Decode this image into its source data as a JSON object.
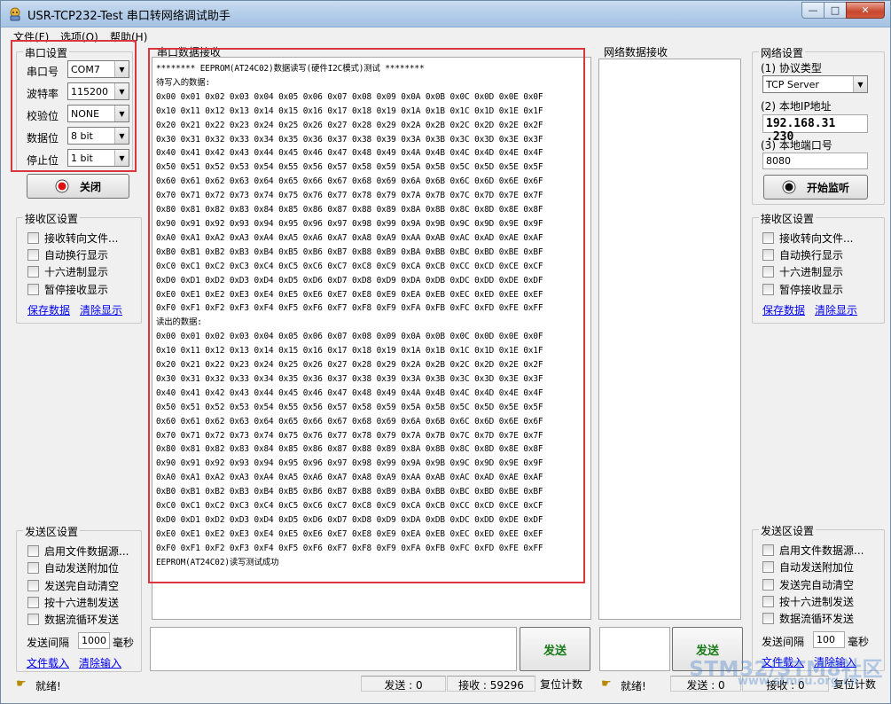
{
  "window": {
    "title": "USR-TCP232-Test 串口转网络调试助手",
    "controls": {
      "minimize": "—",
      "maximize": "□",
      "close": "✕"
    }
  },
  "menu": [
    "文件(F)",
    "选项(O)",
    "帮助(H)"
  ],
  "serial_settings": {
    "title": "串口设置",
    "fields": [
      {
        "label": "串口号",
        "value": "COM7"
      },
      {
        "label": "波特率",
        "value": "115200"
      },
      {
        "label": "校验位",
        "value": "NONE"
      },
      {
        "label": "数据位",
        "value": "8 bit"
      },
      {
        "label": "停止位",
        "value": "1 bit"
      }
    ],
    "close_button": "关闭"
  },
  "left_receive_settings": {
    "title": "接收区设置",
    "options": [
      "接收转向文件...",
      "自动换行显示",
      "十六进制显示",
      "暂停接收显示"
    ],
    "save_link": "保存数据",
    "clear_link": "清除显示"
  },
  "left_send_settings": {
    "title": "发送区设置",
    "options": [
      "启用文件数据源...",
      "自动发送附加位",
      "发送完自动清空",
      "按十六进制发送",
      "数据流循环发送"
    ],
    "interval_label": "发送间隔",
    "interval_value": "1000",
    "interval_unit": "毫秒",
    "load_link": "文件载入",
    "clear_link": "清除输入"
  },
  "serial_receive": {
    "title": "串口数据接收",
    "header": "******** EEPROM(AT24C02)数据读写(硬件I2C模式)测试 ********",
    "write_label": "待写入的数据:",
    "write_rows": [
      "0x00 0x01 0x02 0x03 0x04 0x05 0x06 0x07 0x08 0x09 0x0A 0x0B 0x0C 0x0D 0x0E 0x0F",
      "0x10 0x11 0x12 0x13 0x14 0x15 0x16 0x17 0x18 0x19 0x1A 0x1B 0x1C 0x1D 0x1E 0x1F",
      "0x20 0x21 0x22 0x23 0x24 0x25 0x26 0x27 0x28 0x29 0x2A 0x2B 0x2C 0x2D 0x2E 0x2F",
      "0x30 0x31 0x32 0x33 0x34 0x35 0x36 0x37 0x38 0x39 0x3A 0x3B 0x3C 0x3D 0x3E 0x3F",
      "0x40 0x41 0x42 0x43 0x44 0x45 0x46 0x47 0x48 0x49 0x4A 0x4B 0x4C 0x4D 0x4E 0x4F",
      "0x50 0x51 0x52 0x53 0x54 0x55 0x56 0x57 0x58 0x59 0x5A 0x5B 0x5C 0x5D 0x5E 0x5F",
      "0x60 0x61 0x62 0x63 0x64 0x65 0x66 0x67 0x68 0x69 0x6A 0x6B 0x6C 0x6D 0x6E 0x6F",
      "0x70 0x71 0x72 0x73 0x74 0x75 0x76 0x77 0x78 0x79 0x7A 0x7B 0x7C 0x7D 0x7E 0x7F",
      "0x80 0x81 0x82 0x83 0x84 0x85 0x86 0x87 0x88 0x89 0x8A 0x8B 0x8C 0x8D 0x8E 0x8F",
      "0x90 0x91 0x92 0x93 0x94 0x95 0x96 0x97 0x98 0x99 0x9A 0x9B 0x9C 0x9D 0x9E 0x9F",
      "0xA0 0xA1 0xA2 0xA3 0xA4 0xA5 0xA6 0xA7 0xA8 0xA9 0xAA 0xAB 0xAC 0xAD 0xAE 0xAF",
      "0xB0 0xB1 0xB2 0xB3 0xB4 0xB5 0xB6 0xB7 0xB8 0xB9 0xBA 0xBB 0xBC 0xBD 0xBE 0xBF",
      "0xC0 0xC1 0xC2 0xC3 0xC4 0xC5 0xC6 0xC7 0xC8 0xC9 0xCA 0xCB 0xCC 0xCD 0xCE 0xCF",
      "0xD0 0xD1 0xD2 0xD3 0xD4 0xD5 0xD6 0xD7 0xD8 0xD9 0xDA 0xDB 0xDC 0xDD 0xDE 0xDF",
      "0xE0 0xE1 0xE2 0xE3 0xE4 0xE5 0xE6 0xE7 0xE8 0xE9 0xEA 0xEB 0xEC 0xED 0xEE 0xEF",
      "0xF0 0xF1 0xF2 0xF3 0xF4 0xF5 0xF6 0xF7 0xF8 0xF9 0xFA 0xFB 0xFC 0xFD 0xFE 0xFF"
    ],
    "read_label": "读出的数据:",
    "read_rows": [
      "0x00 0x01 0x02 0x03 0x04 0x05 0x06 0x07 0x08 0x09 0x0A 0x0B 0x0C 0x0D 0x0E 0x0F",
      "0x10 0x11 0x12 0x13 0x14 0x15 0x16 0x17 0x18 0x19 0x1A 0x1B 0x1C 0x1D 0x1E 0x1F",
      "0x20 0x21 0x22 0x23 0x24 0x25 0x26 0x27 0x28 0x29 0x2A 0x2B 0x2C 0x2D 0x2E 0x2F",
      "0x30 0x31 0x32 0x33 0x34 0x35 0x36 0x37 0x38 0x39 0x3A 0x3B 0x3C 0x3D 0x3E 0x3F",
      "0x40 0x41 0x42 0x43 0x44 0x45 0x46 0x47 0x48 0x49 0x4A 0x4B 0x4C 0x4D 0x4E 0x4F",
      "0x50 0x51 0x52 0x53 0x54 0x55 0x56 0x57 0x58 0x59 0x5A 0x5B 0x5C 0x5D 0x5E 0x5F",
      "0x60 0x61 0x62 0x63 0x64 0x65 0x66 0x67 0x68 0x69 0x6A 0x6B 0x6C 0x6D 0x6E 0x6F",
      "0x70 0x71 0x72 0x73 0x74 0x75 0x76 0x77 0x78 0x79 0x7A 0x7B 0x7C 0x7D 0x7E 0x7F",
      "0x80 0x81 0x82 0x83 0x84 0x85 0x86 0x87 0x88 0x89 0x8A 0x8B 0x8C 0x8D 0x8E 0x8F",
      "0x90 0x91 0x92 0x93 0x94 0x95 0x96 0x97 0x98 0x99 0x9A 0x9B 0x9C 0x9D 0x9E 0x9F",
      "0xA0 0xA1 0xA2 0xA3 0xA4 0xA5 0xA6 0xA7 0xA8 0xA9 0xAA 0xAB 0xAC 0xAD 0xAE 0xAF",
      "0xB0 0xB1 0xB2 0xB3 0xB4 0xB5 0xB6 0xB7 0xB8 0xB9 0xBA 0xBB 0xBC 0xBD 0xBE 0xBF",
      "0xC0 0xC1 0xC2 0xC3 0xC4 0xC5 0xC6 0xC7 0xC8 0xC9 0xCA 0xCB 0xCC 0xCD 0xCE 0xCF",
      "0xD0 0xD1 0xD2 0xD3 0xD4 0xD5 0xD6 0xD7 0xD8 0xD9 0xDA 0xDB 0xDC 0xDD 0xDE 0xDF",
      "0xE0 0xE1 0xE2 0xE3 0xE4 0xE5 0xE6 0xE7 0xE8 0xE9 0xEA 0xEB 0xEC 0xED 0xEE 0xEF",
      "0xF0 0xF1 0xF2 0xF3 0xF4 0xF5 0xF6 0xF7 0xF8 0xF9 0xFA 0xFB 0xFC 0xFD 0xFE 0xFF"
    ],
    "footer": "EEPROM(AT24C02)读写测试成功"
  },
  "network_receive": {
    "title": "网络数据接收"
  },
  "network_settings": {
    "title": "网络设置",
    "protocol_label": "(1) 协议类型",
    "protocol_value": "TCP Server",
    "ip_label": "(2) 本地IP地址",
    "ip_value": "192.168.31 .230",
    "port_label": "(3) 本地端口号",
    "port_value": "8080",
    "listen_button": "开始监听"
  },
  "right_receive_settings": {
    "title": "接收区设置",
    "options": [
      "接收转向文件...",
      "自动换行显示",
      "十六进制显示",
      "暂停接收显示"
    ],
    "save_link": "保存数据",
    "clear_link": "清除显示"
  },
  "right_send_settings": {
    "title": "发送区设置",
    "options": [
      "启用文件数据源...",
      "自动发送附加位",
      "发送完自动清空",
      "按十六进制发送",
      "数据流循环发送"
    ],
    "interval_label": "发送间隔",
    "interval_value": "100",
    "interval_unit": "毫秒",
    "load_link": "文件载入",
    "clear_link": "清除输入"
  },
  "send_buttons": {
    "serial": "发送",
    "network": "发送"
  },
  "statusbar": {
    "serial_ready": "就绪!",
    "serial_send": "发送 : 0",
    "serial_recv": "接收 : 59296",
    "serial_reset": "复位计数",
    "net_ready": "就绪!",
    "net_send": "发送 : 0",
    "net_recv": "接收 : 0",
    "net_reset": "复位计数"
  },
  "watermark": {
    "brand": "STM32/STM8社区",
    "url": "www.stmcu.org.cn"
  },
  "colors": {
    "highlight_box": "#d9363e",
    "send_text": "#1a7a1a",
    "link": "#0000ee"
  }
}
